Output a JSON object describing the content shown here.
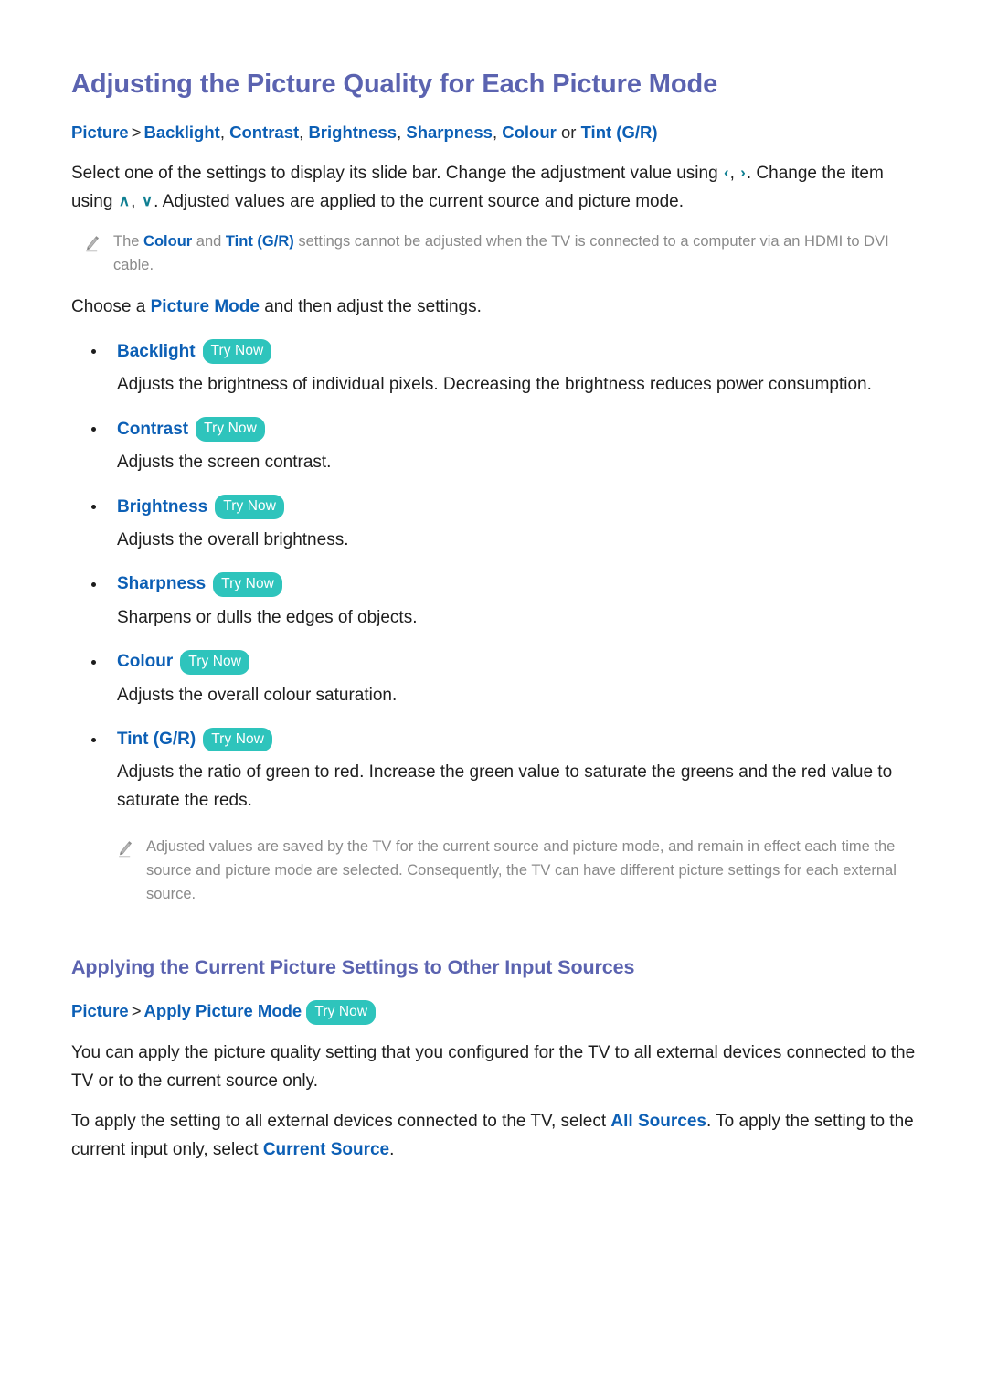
{
  "document": {
    "title": "Adjusting the Picture Quality for Each Picture Mode"
  },
  "colors": {
    "heading": "#5B63B0",
    "link_blue": "#0C5FB5",
    "badge_teal": "#2EC4BC",
    "body_text": "#1E1E1E",
    "note_gray": "#8A8A8A",
    "chevron_teal": "#0F7F92"
  },
  "breadcrumb_1": {
    "root": "Picture",
    "separator": ">",
    "items": [
      "Backlight",
      "Contrast",
      "Brightness",
      "Sharpness",
      "Colour"
    ],
    "conjunction": "or",
    "last_item": "Tint (G/R)"
  },
  "intro": {
    "part1": "Select one of the settings to display its slide bar. Change the adjustment value using ",
    "chevron_left": "‹",
    "comma1": ", ",
    "chevron_right": "›",
    "part2": ". Change the item using ",
    "chevron_up": "∧",
    "comma2": ", ",
    "chevron_down": "∨",
    "part3": ". Adjusted values are applied to the current source and picture mode."
  },
  "note_1": {
    "icon": "pencil-icon",
    "text_part1": "The ",
    "keyword1": "Colour",
    "text_part2": " and ",
    "keyword2": "Tint (G/R)",
    "text_part3": " settings cannot be adjusted when the TV is connected to a computer via an HDMI to DVI cable."
  },
  "choose_line": {
    "part1": "Choose a ",
    "keyword": "Picture Mode",
    "part2": " and then adjust the settings."
  },
  "settings": [
    {
      "label": "Backlight",
      "badge": "Try Now",
      "description": "Adjusts the brightness of individual pixels. Decreasing the brightness reduces power consumption."
    },
    {
      "label": "Contrast",
      "badge": "Try Now",
      "description": "Adjusts the screen contrast."
    },
    {
      "label": "Brightness",
      "badge": "Try Now",
      "description": "Adjusts the overall brightness."
    },
    {
      "label": "Sharpness",
      "badge": "Try Now",
      "description": "Sharpens or dulls the edges of objects."
    },
    {
      "label": "Colour",
      "badge": "Try Now",
      "description": "Adjusts the overall colour saturation."
    },
    {
      "label": "Tint (G/R)",
      "badge": "Try Now",
      "description": "Adjusts the ratio of green to red. Increase the green value to saturate the greens and the red value to saturate the reds."
    }
  ],
  "note_2": {
    "icon": "pencil-icon",
    "text": "Adjusted values are saved by the TV for the current source and picture mode, and remain in effect each time the source and picture mode are selected. Consequently, the TV can have different picture settings for each external source."
  },
  "section_2": {
    "title": "Applying the Current Picture Settings to Other Input Sources",
    "breadcrumb": {
      "root": "Picture",
      "separator": ">",
      "item": "Apply Picture Mode",
      "badge": "Try Now"
    },
    "paragraph_1": "You can apply the picture quality setting that you configured for the TV to all external devices connected to the TV or to the current source only.",
    "paragraph_2": {
      "part1": "To apply the setting to all external devices connected to the TV, select ",
      "keyword1": "All Sources",
      "part2": ". To apply the setting to the current input only, select ",
      "keyword2": "Current Source",
      "part3": "."
    }
  }
}
